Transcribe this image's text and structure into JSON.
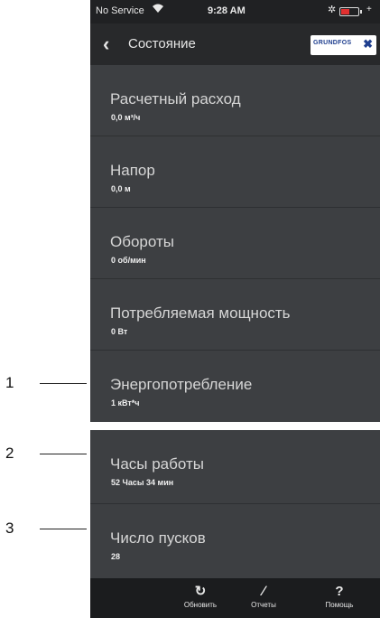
{
  "callouts": [
    "1",
    "2",
    "3"
  ],
  "status_bar": {
    "carrier": "No Service",
    "time": "9:28 AM"
  },
  "navbar": {
    "back_icon": "chevron-left",
    "title": "Состояние",
    "brand": "GRUNDFOS"
  },
  "items": [
    {
      "label": "Расчетный расход",
      "value": "0,0 м³/ч"
    },
    {
      "label": "Напор",
      "value": "0,0 м"
    },
    {
      "label": "Обороты",
      "value": "0 об/мин"
    },
    {
      "label": "Потребляемая мощность",
      "value": "0 Вт"
    },
    {
      "label": "Энергопотребление",
      "value": "1 кВт*ч"
    },
    {
      "label": "Часы работы",
      "value": "52 Часы 34 мин"
    },
    {
      "label": "Число пусков",
      "value": "28"
    }
  ],
  "toolbar": [
    {
      "icon": "refresh-icon",
      "label": "Обновить"
    },
    {
      "icon": "pencil-icon",
      "label": "Отчеты"
    },
    {
      "icon": "help-icon",
      "label": "Помощь"
    }
  ],
  "colors": {
    "background": "#3d3f42",
    "navbar": "#28292b",
    "toolbar": "#1b1c1e",
    "battery_low": "#e23030"
  }
}
